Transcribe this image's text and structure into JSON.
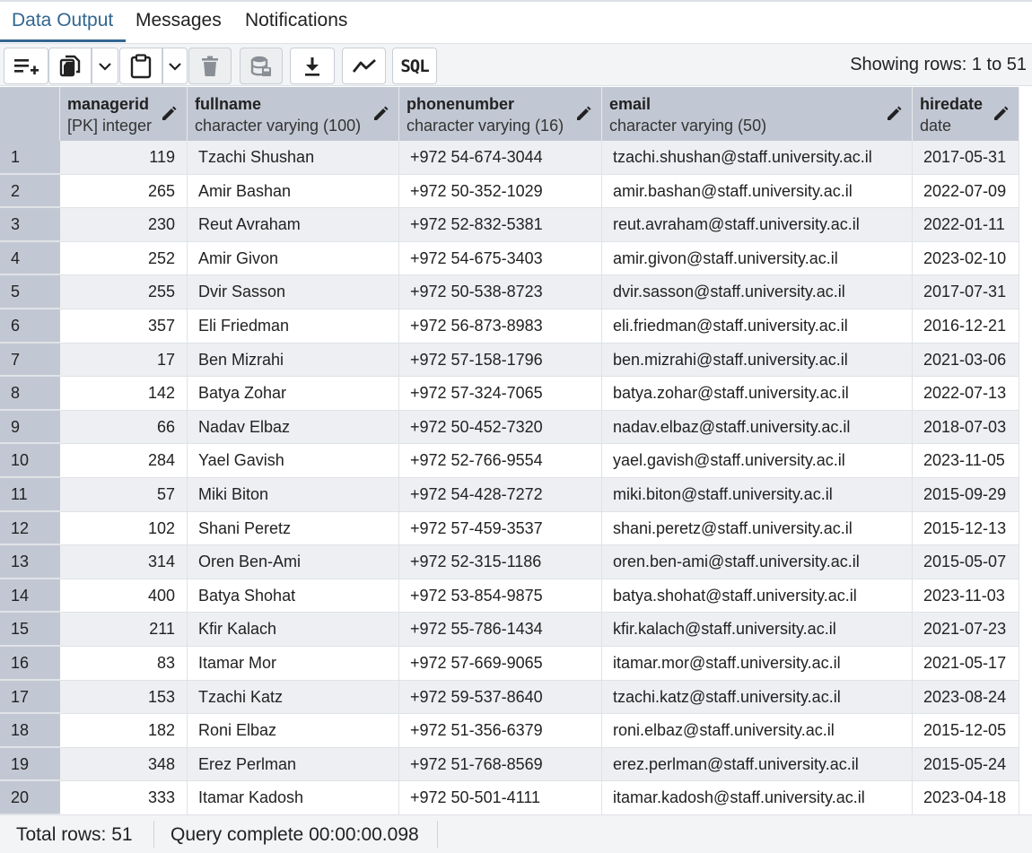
{
  "tabs": [
    {
      "label": "Data Output",
      "active": true
    },
    {
      "label": "Messages",
      "active": false
    },
    {
      "label": "Notifications",
      "active": false
    }
  ],
  "toolbar": {
    "buttons": [
      {
        "icon": "add-row-icon"
      },
      {
        "icon": "copy-icon"
      },
      {
        "icon": "chevron-down-icon"
      },
      {
        "icon": "paste-icon"
      },
      {
        "icon": "chevron-down-icon"
      },
      {
        "icon": "trash-icon"
      },
      {
        "icon": "save-data-icon"
      },
      {
        "icon": "download-icon"
      },
      {
        "icon": "graph-icon"
      },
      {
        "icon": "sql-icon",
        "label": "SQL"
      }
    ],
    "status": "Showing rows: 1 to 51"
  },
  "columns": [
    {
      "name": "managerid",
      "type": "[PK] integer"
    },
    {
      "name": "fullname",
      "type": "character varying (100)"
    },
    {
      "name": "phonenumber",
      "type": "character varying (16)"
    },
    {
      "name": "email",
      "type": "character varying (50)"
    },
    {
      "name": "hiredate",
      "type": "date"
    }
  ],
  "rows": [
    [
      "1",
      "119",
      "Tzachi Shushan",
      "+972 54-674-3044",
      "tzachi.shushan@staff.university.ac.il",
      "2017-05-31"
    ],
    [
      "2",
      "265",
      "Amir Bashan",
      "+972 50-352-1029",
      "amir.bashan@staff.university.ac.il",
      "2022-07-09"
    ],
    [
      "3",
      "230",
      "Reut Avraham",
      "+972 52-832-5381",
      "reut.avraham@staff.university.ac.il",
      "2022-01-11"
    ],
    [
      "4",
      "252",
      "Amir Givon",
      "+972 54-675-3403",
      "amir.givon@staff.university.ac.il",
      "2023-02-10"
    ],
    [
      "5",
      "255",
      "Dvir Sasson",
      "+972 50-538-8723",
      "dvir.sasson@staff.university.ac.il",
      "2017-07-31"
    ],
    [
      "6",
      "357",
      "Eli Friedman",
      "+972 56-873-8983",
      "eli.friedman@staff.university.ac.il",
      "2016-12-21"
    ],
    [
      "7",
      "17",
      "Ben Mizrahi",
      "+972 57-158-1796",
      "ben.mizrahi@staff.university.ac.il",
      "2021-03-06"
    ],
    [
      "8",
      "142",
      "Batya Zohar",
      "+972 57-324-7065",
      "batya.zohar@staff.university.ac.il",
      "2022-07-13"
    ],
    [
      "9",
      "66",
      "Nadav Elbaz",
      "+972 50-452-7320",
      "nadav.elbaz@staff.university.ac.il",
      "2018-07-03"
    ],
    [
      "10",
      "284",
      "Yael Gavish",
      "+972 52-766-9554",
      "yael.gavish@staff.university.ac.il",
      "2023-11-05"
    ],
    [
      "11",
      "57",
      "Miki Biton",
      "+972 54-428-7272",
      "miki.biton@staff.university.ac.il",
      "2015-09-29"
    ],
    [
      "12",
      "102",
      "Shani Peretz",
      "+972 57-459-3537",
      "shani.peretz@staff.university.ac.il",
      "2015-12-13"
    ],
    [
      "13",
      "314",
      "Oren Ben-Ami",
      "+972 52-315-1186",
      "oren.ben-ami@staff.university.ac.il",
      "2015-05-07"
    ],
    [
      "14",
      "400",
      "Batya Shohat",
      "+972 53-854-9875",
      "batya.shohat@staff.university.ac.il",
      "2023-11-03"
    ],
    [
      "15",
      "211",
      "Kfir Kalach",
      "+972 55-786-1434",
      "kfir.kalach@staff.university.ac.il",
      "2021-07-23"
    ],
    [
      "16",
      "83",
      "Itamar Mor",
      "+972 57-669-9065",
      "itamar.mor@staff.university.ac.il",
      "2021-05-17"
    ],
    [
      "17",
      "153",
      "Tzachi Katz",
      "+972 59-537-8640",
      "tzachi.katz@staff.university.ac.il",
      "2023-08-24"
    ],
    [
      "18",
      "182",
      "Roni Elbaz",
      "+972 51-356-6379",
      "roni.elbaz@staff.university.ac.il",
      "2015-12-05"
    ],
    [
      "19",
      "348",
      "Erez Perlman",
      "+972 51-768-8569",
      "erez.perlman@staff.university.ac.il",
      "2015-05-24"
    ],
    [
      "20",
      "333",
      "Itamar Kadosh",
      "+972 50-501-4111",
      "itamar.kadosh@staff.university.ac.il",
      "2023-04-18"
    ]
  ],
  "footer": {
    "total_rows": "Total rows: 51",
    "query_status": "Query complete 00:00:00.098"
  },
  "colors": {
    "accent": "#326690",
    "header_bg": "#c2c8d3",
    "row_alt_bg": "#edeff2",
    "toolbar_bg": "#f3f4f6"
  }
}
